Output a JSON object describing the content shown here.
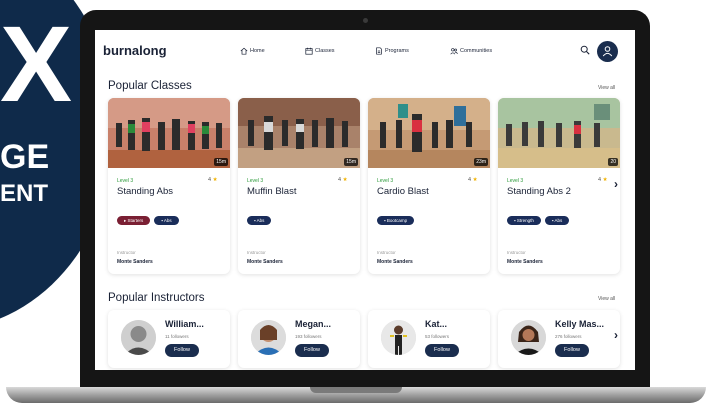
{
  "promo": {
    "big_letter": "X",
    "line1": "GE",
    "line2": "ENT",
    "color": "#0f2a4a"
  },
  "nav": {
    "logo": "burnalong",
    "items": [
      {
        "label": "Home",
        "icon": "home-icon"
      },
      {
        "label": "Classes",
        "icon": "calendar-icon"
      },
      {
        "label": "Programs",
        "icon": "document-icon"
      },
      {
        "label": "Communities",
        "icon": "people-icon"
      }
    ],
    "search_icon": "search-icon",
    "avatar_icon": "user-icon"
  },
  "classes_section": {
    "title": "Popular Classes",
    "view_all": "View all",
    "cards": [
      {
        "duration": "15m",
        "level": "Level 3",
        "rating": "4",
        "title": "Standing Abs",
        "tags": [
          {
            "label": "Starters",
            "icon": "runner-icon",
            "color": "#7a1f33"
          },
          {
            "label": "Abs",
            "icon": "core-icon",
            "color": "#1a2d5a"
          }
        ],
        "instructor_label": "Instructor",
        "instructor": "Monte Sanders"
      },
      {
        "duration": "15m",
        "level": "Level 3",
        "rating": "4",
        "title": "Muffin Blast",
        "tags": [
          {
            "label": "Abs",
            "icon": "core-icon",
            "color": "#1a2d5a"
          }
        ],
        "instructor_label": "Instructor",
        "instructor": "Monte Sanders"
      },
      {
        "duration": "23m",
        "level": "Level 3",
        "rating": "4",
        "title": "Cardio Blast",
        "tags": [
          {
            "label": "Bootcamp",
            "icon": "bootcamp-icon",
            "color": "#1a2d5a"
          }
        ],
        "instructor_label": "Instructor",
        "instructor": "Monte Sanders"
      },
      {
        "duration": "20",
        "level": "Level 3",
        "rating": "4",
        "title": "Standing Abs 2",
        "tags": [
          {
            "label": "Strength",
            "icon": "dumbbell-icon",
            "color": "#1a2d5a"
          },
          {
            "label": "Abs",
            "icon": "core-icon",
            "color": "#1a2d5a"
          }
        ],
        "instructor_label": "Instructor",
        "instructor": "Monte Sanders"
      }
    ],
    "next_arrow": "›"
  },
  "instructors_section": {
    "title": "Popular Instructors",
    "view_all": "View all",
    "items": [
      {
        "name": "William...",
        "followers": "11 followers",
        "follow_label": "Follow"
      },
      {
        "name": "Megan...",
        "followers": "193 followers",
        "follow_label": "Follow"
      },
      {
        "name": "Kat...",
        "followers": "53 followers",
        "follow_label": "Follow"
      },
      {
        "name": "Kelly Mas...",
        "followers": "276 followers",
        "follow_label": "Follow"
      }
    ],
    "next_arrow": "›"
  },
  "colors": {
    "navy": "#1a2d4e",
    "level_green": "#2b9a3a",
    "star": "#f2b200",
    "tag_maroon": "#7a1f33"
  }
}
